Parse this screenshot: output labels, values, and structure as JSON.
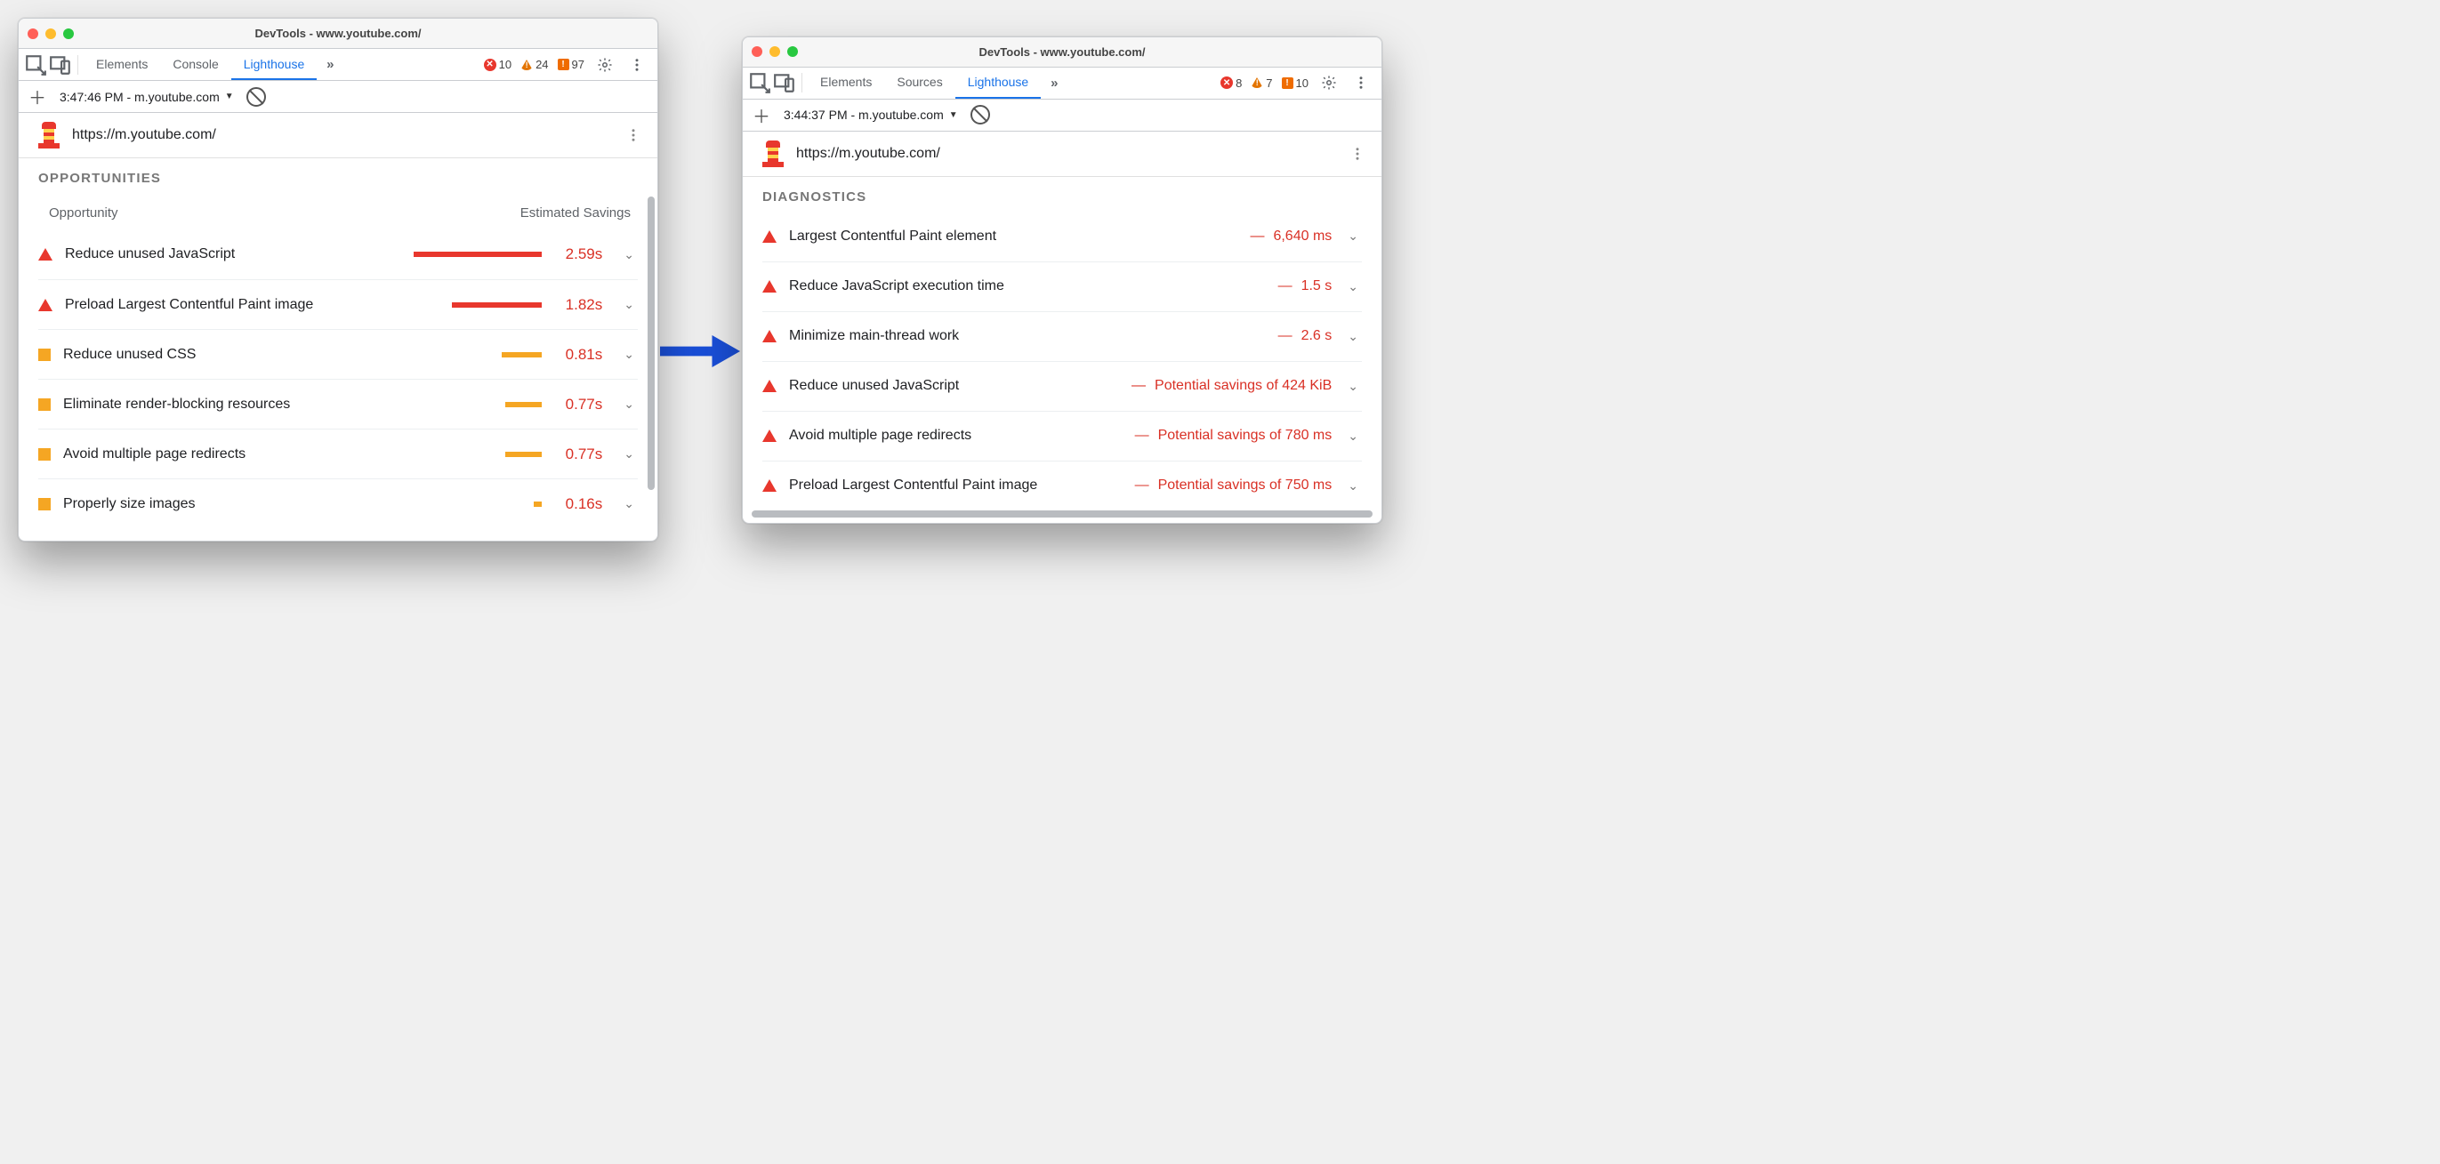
{
  "left": {
    "title": "DevTools - www.youtube.com/",
    "tabs": [
      "Elements",
      "Console",
      "Lighthouse"
    ],
    "active_tab": "Lighthouse",
    "counts": {
      "errors": 10,
      "warnings": 24,
      "info": 97
    },
    "run_label": "3:47:46 PM - m.youtube.com",
    "url": "https://m.youtube.com/",
    "section": "OPPORTUNITIES",
    "col_labels": {
      "left": "Opportunity",
      "right": "Estimated Savings"
    },
    "opportunities": [
      {
        "sev": "tri",
        "title": "Reduce unused JavaScript",
        "value": "2.59s",
        "bar_pct": 80,
        "bar_color": "red"
      },
      {
        "sev": "tri",
        "title": "Preload Largest Contentful Paint image",
        "value": "1.82s",
        "bar_pct": 56,
        "bar_color": "red"
      },
      {
        "sev": "sq",
        "title": "Reduce unused CSS",
        "value": "0.81s",
        "bar_pct": 25,
        "bar_color": "orange"
      },
      {
        "sev": "sq",
        "title": "Eliminate render-blocking resources",
        "value": "0.77s",
        "bar_pct": 23,
        "bar_color": "orange"
      },
      {
        "sev": "sq",
        "title": "Avoid multiple page redirects",
        "value": "0.77s",
        "bar_pct": 23,
        "bar_color": "orange"
      },
      {
        "sev": "sq",
        "title": "Properly size images",
        "value": "0.16s",
        "bar_pct": 5,
        "bar_color": "orange"
      }
    ]
  },
  "right": {
    "title": "DevTools - www.youtube.com/",
    "tabs": [
      "Elements",
      "Sources",
      "Lighthouse"
    ],
    "active_tab": "Lighthouse",
    "counts": {
      "errors": 8,
      "warnings": 7,
      "info": 10
    },
    "run_label": "3:44:37 PM - m.youtube.com",
    "url": "https://m.youtube.com/",
    "section": "DIAGNOSTICS",
    "diagnostics": [
      {
        "sev": "tri",
        "title": "Largest Contentful Paint element",
        "extra": "6,640 ms"
      },
      {
        "sev": "tri",
        "title": "Reduce JavaScript execution time",
        "extra": "1.5 s"
      },
      {
        "sev": "tri",
        "title": "Minimize main-thread work",
        "extra": "2.6 s"
      },
      {
        "sev": "tri",
        "title": "Reduce unused JavaScript",
        "extra": "Potential savings of 424 KiB"
      },
      {
        "sev": "tri",
        "title": "Avoid multiple page redirects",
        "extra": "Potential savings of 780 ms"
      },
      {
        "sev": "tri",
        "title": "Preload Largest Contentful Paint image",
        "extra": "Potential savings of 750 ms"
      }
    ]
  }
}
